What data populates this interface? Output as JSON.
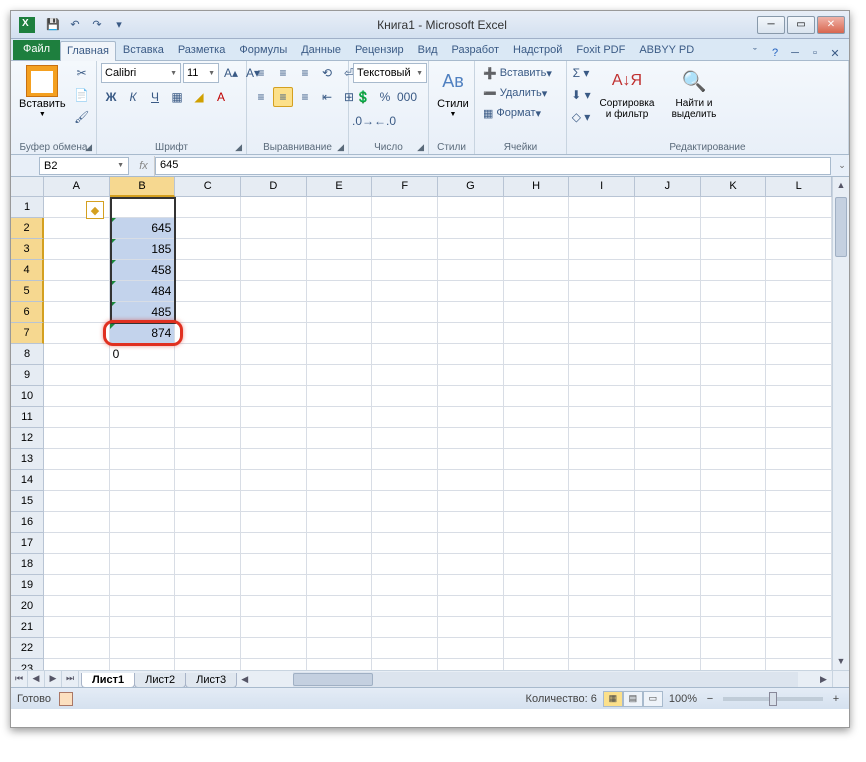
{
  "title": "Книга1 - Microsoft Excel",
  "qat": {
    "save": "💾",
    "undo": "↶",
    "redo": "↷"
  },
  "tabs": {
    "file": "Файл",
    "items": [
      "Главная",
      "Вставка",
      "Разметка",
      "Формулы",
      "Данные",
      "Рецензир",
      "Вид",
      "Разработ",
      "Надстрой",
      "Foxit PDF",
      "ABBYY PD"
    ],
    "active": 0
  },
  "ribbon": {
    "clipboard": {
      "paste": "Вставить",
      "label": "Буфер обмена"
    },
    "font": {
      "name": "Calibri",
      "size": "11",
      "label": "Шрифт",
      "bold": "Ж",
      "italic": "К",
      "underline": "Ч"
    },
    "align": {
      "label": "Выравнивание",
      "wrap": "≡",
      "merge": "⊞"
    },
    "number": {
      "format": "Текстовый",
      "label": "Число"
    },
    "styles": {
      "label": "Стили",
      "btn": "Стили"
    },
    "cells": {
      "insert": "Вставить",
      "delete": "Удалить",
      "format": "Формат",
      "label": "Ячейки"
    },
    "editing": {
      "sort": "Сортировка и фильтр",
      "find": "Найти и выделить",
      "label": "Редактирование"
    }
  },
  "formulabar": {
    "namebox": "B2",
    "fx": "fx",
    "value": "645"
  },
  "columns": [
    "A",
    "B",
    "C",
    "D",
    "E",
    "F",
    "G",
    "H",
    "I",
    "J",
    "K",
    "L"
  ],
  "rows_count": 23,
  "selected_col": "B",
  "selected_rows_from": 2,
  "selected_rows_to": 7,
  "cells": {
    "B2": "645",
    "B3": "185",
    "B4": "458",
    "B5": "484",
    "B6": "485",
    "B7": "874",
    "B8": "0"
  },
  "sheets": {
    "items": [
      "Лист1",
      "Лист2",
      "Лист3"
    ],
    "active": 0
  },
  "status": {
    "ready": "Готово",
    "count_label": "Количество:",
    "count_value": "6",
    "zoom": "100%"
  }
}
